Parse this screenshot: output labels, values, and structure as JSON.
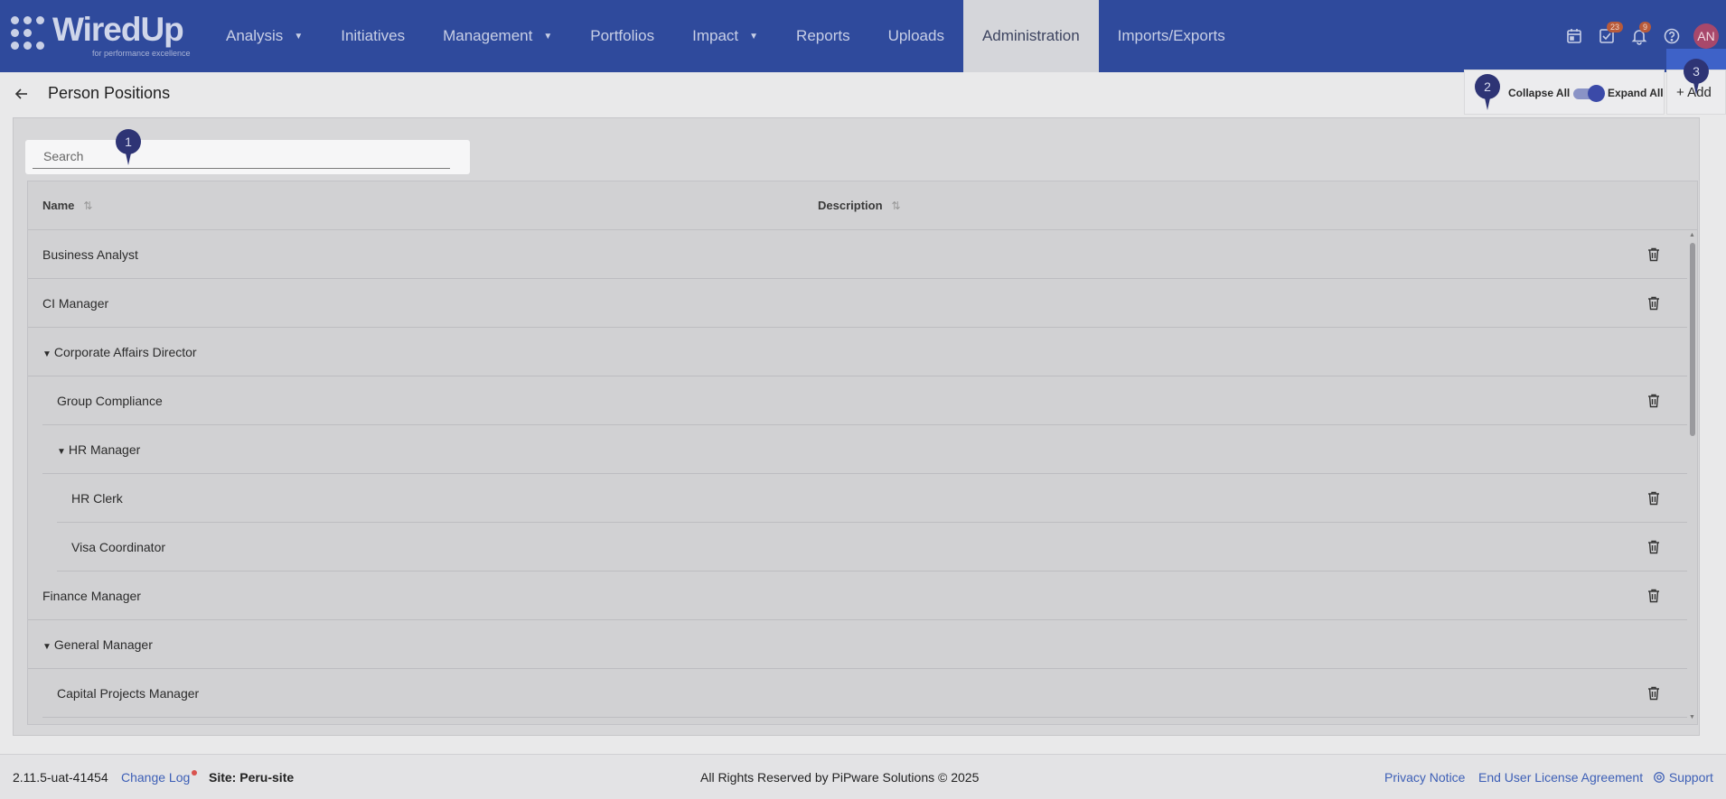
{
  "app": {
    "logo_text": "WiredUp",
    "logo_tagline": "for performance excellence"
  },
  "nav": {
    "items": [
      {
        "label": "Analysis",
        "caret": true
      },
      {
        "label": "Initiatives",
        "caret": false
      },
      {
        "label": "Management",
        "caret": true
      },
      {
        "label": "Portfolios",
        "caret": false
      },
      {
        "label": "Impact",
        "caret": true
      },
      {
        "label": "Reports",
        "caret": false
      },
      {
        "label": "Uploads",
        "caret": false
      },
      {
        "label": "Administration",
        "caret": false,
        "active": true
      },
      {
        "label": "Imports/Exports",
        "caret": false
      }
    ],
    "tasks_badge": "23",
    "notifications_badge": "9",
    "avatar_initials": "AN",
    "icons": [
      "calendar-icon",
      "tasks-icon",
      "bell-icon",
      "help-icon"
    ]
  },
  "page": {
    "title": "Person Positions",
    "collapse_label": "Collapse All",
    "expand_label": "Expand All",
    "expand_on": true,
    "add_label": "+ Add"
  },
  "tour_markers": [
    "1",
    "2",
    "3"
  ],
  "search": {
    "placeholder": "Search",
    "value": ""
  },
  "grid": {
    "columns": [
      "Name",
      "Description"
    ],
    "rows": [
      {
        "name": "Business Analyst",
        "level": 0,
        "expandable": false,
        "deletable": true
      },
      {
        "name": "CI Manager",
        "level": 0,
        "expandable": false,
        "deletable": true
      },
      {
        "name": "Corporate Affairs Director",
        "level": 0,
        "expandable": true,
        "deletable": false
      },
      {
        "name": "Group Compliance",
        "level": 1,
        "expandable": false,
        "deletable": true
      },
      {
        "name": "HR Manager",
        "level": 1,
        "expandable": true,
        "deletable": false
      },
      {
        "name": "HR Clerk",
        "level": 2,
        "expandable": false,
        "deletable": true
      },
      {
        "name": "Visa Coordinator",
        "level": 2,
        "expandable": false,
        "deletable": true
      },
      {
        "name": "Finance Manager",
        "level": 0,
        "expandable": false,
        "deletable": true
      },
      {
        "name": "General Manager",
        "level": 0,
        "expandable": true,
        "deletable": false
      },
      {
        "name": "Capital Projects Manager",
        "level": 1,
        "expandable": false,
        "deletable": true
      }
    ]
  },
  "footer": {
    "version": "2.11.5-uat-41454",
    "changelog": "Change Log",
    "site": "Site: Peru-site",
    "copyright": "All Rights Reserved by PiPware Solutions © 2025",
    "privacy": "Privacy Notice",
    "eula": "End User License Agreement",
    "support": "Support"
  },
  "colors": {
    "nav_bg": "#2f4a9c",
    "marker": "#2e3475",
    "link": "#3d5fb6",
    "badge": "#b85a3a",
    "avatar": "#a8486b"
  }
}
